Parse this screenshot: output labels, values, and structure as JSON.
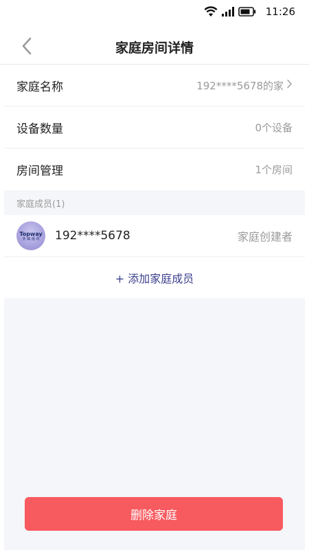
{
  "status_bar": {
    "time": "11:26",
    "icons": [
      "wifi-icon",
      "signal-icon",
      "battery-icon"
    ]
  },
  "nav": {
    "title": "家庭房间详情",
    "back_icon": "chevron-left-icon"
  },
  "family": {
    "name_label": "家庭名称",
    "name_value": "192****5678的家",
    "device_label": "设备数量",
    "device_value": "0个设备",
    "room_label": "房间管理",
    "room_value": "1个房间"
  },
  "members": {
    "header": "家庭成员(1)",
    "items": [
      {
        "avatar_text": "Topway",
        "avatar_sub": "天 威 视 讯",
        "name": "192****5678",
        "role": "家庭创建者"
      }
    ],
    "add_label": "+ 添加家庭成员"
  },
  "footer": {
    "delete_label": "删除家庭"
  },
  "colors": {
    "accent": "#3b3f8c",
    "danger": "#f75a5f",
    "background": "#f4f6f9",
    "secondary_text": "#9a9a9a"
  }
}
